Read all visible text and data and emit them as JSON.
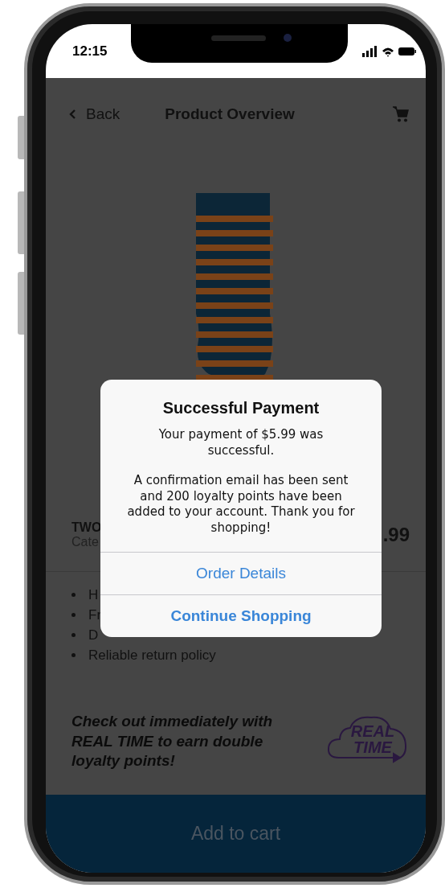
{
  "status_bar": {
    "time": "12:15"
  },
  "nav": {
    "back": "Back",
    "title": "Product Overview"
  },
  "product": {
    "name": "TWO",
    "category": "Cate",
    "price": ".99"
  },
  "features": [
    "H",
    "Fr",
    "D",
    "Reliable return policy"
  ],
  "promo": {
    "text": "Check out immediately with REAL TIME to earn double loyalty points!",
    "logo_lines": [
      "REAL",
      "TIME"
    ]
  },
  "add_to_cart": "Add to cart",
  "dialog": {
    "title": "Successful Payment",
    "messages": [
      "Your payment of $5.99 was successful.",
      "A confirmation email has been sent and 200 loyalty points have been added to your account. Thank you for shopping!"
    ],
    "actions": [
      {
        "label": "Order Details",
        "primary": false
      },
      {
        "label": "Continue Shopping",
        "primary": true
      }
    ]
  }
}
